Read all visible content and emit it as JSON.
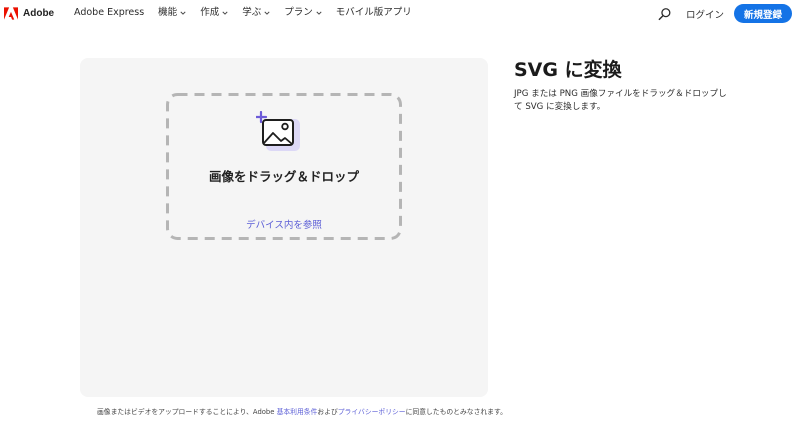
{
  "brand": {
    "name": "Adobe",
    "logo_color": "#eb1000"
  },
  "nav": {
    "items": [
      {
        "label": "Adobe Express",
        "has_dropdown": false
      },
      {
        "label": "機能",
        "has_dropdown": true
      },
      {
        "label": "作成",
        "has_dropdown": true
      },
      {
        "label": "学ぶ",
        "has_dropdown": true
      },
      {
        "label": "プラン",
        "has_dropdown": true
      },
      {
        "label": "モバイル版アプリ",
        "has_dropdown": false
      }
    ]
  },
  "header": {
    "search_icon": "search-icon",
    "login_label": "ログイン",
    "signup_label": "新規登録",
    "accent_color": "#1473e6"
  },
  "upload": {
    "icon": "image-add-icon",
    "title": "画像をドラッグ＆ドロップ",
    "browse_label": "デバイス内を参照",
    "link_color": "#5b5ed6"
  },
  "consent": {
    "prefix": "画像またはビデオをアップロードすることにより、Adobe ",
    "terms_link": "基本利用条件",
    "middle": "および",
    "privacy_link": "プライバシーポリシー",
    "suffix": "に同意したものとみなされます。"
  },
  "main": {
    "title": "SVG に変換",
    "description": "JPG または PNG 画像ファイルをドラッグ＆ドロップして SVG に変換します。"
  }
}
